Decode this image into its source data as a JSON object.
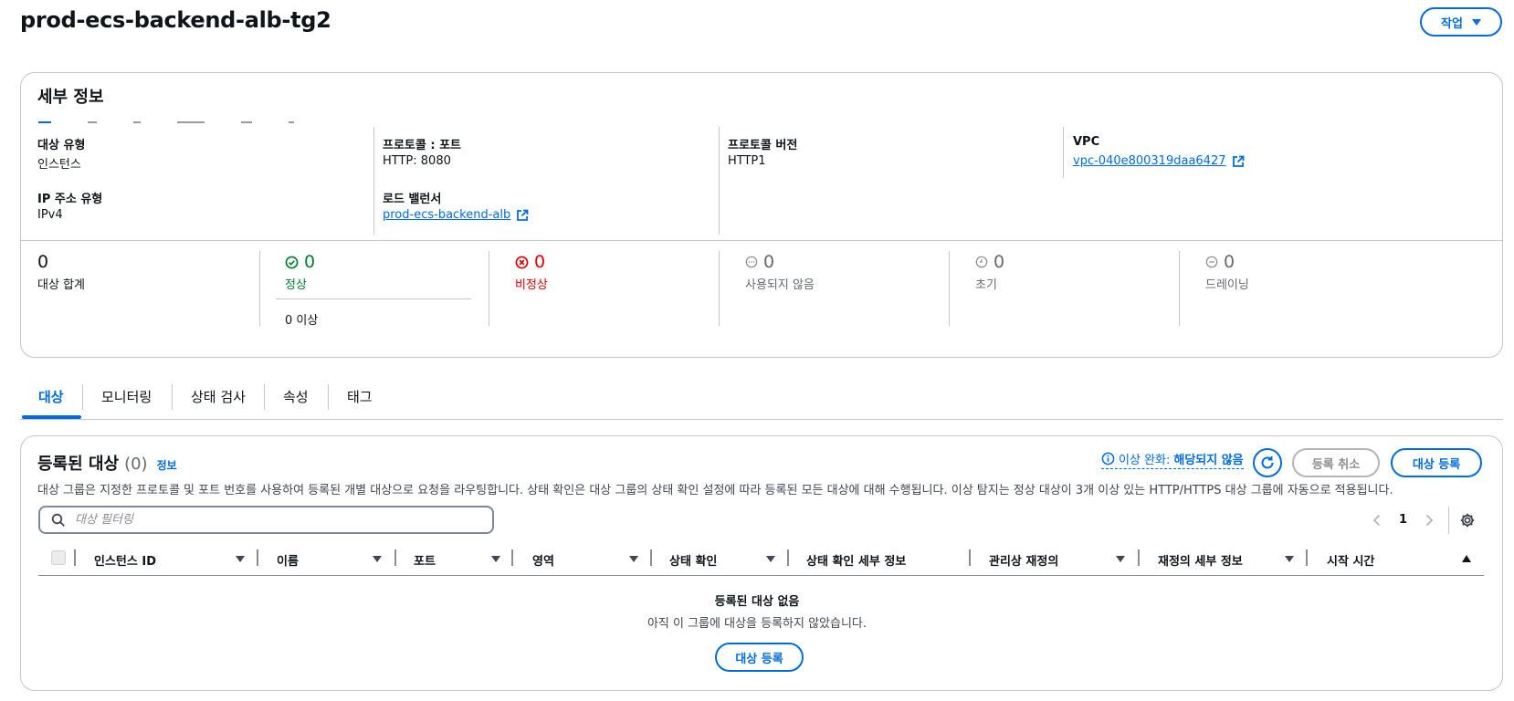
{
  "header": {
    "title": "prod-ecs-backend-alb-tg2",
    "actions_label": "작업"
  },
  "details": {
    "title": "세부 정보",
    "fields": {
      "target_type": {
        "label": "대상 유형",
        "value": "인스턴스"
      },
      "protocol_port": {
        "label": "프로토콜 : 포트",
        "value": "HTTP: 8080"
      },
      "protocol_version": {
        "label": "프로토콜 버전",
        "value": "HTTP1"
      },
      "vpc": {
        "label": "VPC",
        "value": "vpc-040e800319daa6427"
      },
      "ip_type": {
        "label": "IP 주소 유형",
        "value": "IPv4"
      },
      "load_balancer": {
        "label": "로드 밸런서",
        "value": "prod-ecs-backend-alb"
      }
    },
    "stats": {
      "total": {
        "count": "0",
        "label": "대상 합계"
      },
      "healthy": {
        "count": "0",
        "label": "정상",
        "anomaly": "0 이상"
      },
      "unhealthy": {
        "count": "0",
        "label": "비정상"
      },
      "unused": {
        "count": "0",
        "label": "사용되지 않음"
      },
      "initial": {
        "count": "0",
        "label": "초기"
      },
      "draining": {
        "count": "0",
        "label": "드레이닝"
      }
    }
  },
  "tabs": [
    "대상",
    "모니터링",
    "상태 검사",
    "속성",
    "태그"
  ],
  "targets": {
    "title": "등록된 대상",
    "count": "(0)",
    "info_link": "정보",
    "anomaly_prefix": "이상 완화:",
    "anomaly_value": "해당되지 않음",
    "deregister_label": "등록 취소",
    "register_label": "대상 등록",
    "description": "대상 그룹은 지정한 프로토콜 및 포트 번호를 사용하여 등록된 개별 대상으로 요청을 라우팅합니다. 상태 확인은 대상 그룹의 상태 확인 설정에 따라 등록된 모든 대상에 대해 수행됩니다. 이상 탐지는 정상 대상이 3개 이상 있는 HTTP/HTTPS 대상 그룹에 자동으로 적용됩니다.",
    "filter_placeholder": "대상 필터링",
    "page": "1",
    "columns": [
      "인스턴스 ID",
      "이름",
      "포트",
      "영역",
      "상태 확인",
      "상태 확인 세부 정보",
      "관리상 재정의",
      "재정의 세부 정보",
      "시작 시간"
    ],
    "empty_title": "등록된 대상 없음",
    "empty_subtitle": "아직 이 그룹에 대상을 등록하지 않았습니다.",
    "empty_register_label": "대상 등록"
  },
  "colors": {
    "link": "#006ce0",
    "healthy": "#00802f",
    "unhealthy": "#db0000",
    "muted": "#656871"
  }
}
